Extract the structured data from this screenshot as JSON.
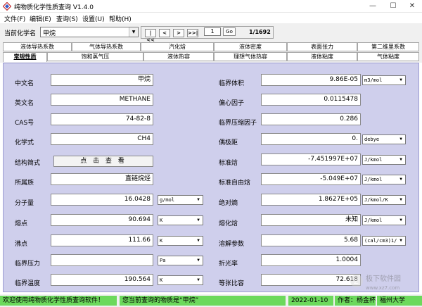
{
  "window": {
    "title": "纯物质化学性质查询 V1.4.0",
    "minimize": "—",
    "maximize": "☐",
    "close": "✕"
  },
  "menu": [
    "文件(F)",
    "编辑(E)",
    "查询(S)",
    "设置(U)",
    "帮助(H)"
  ],
  "toolbar": {
    "label": "当前化学名",
    "compound": "甲烷",
    "nav_first": "|<<",
    "nav_prev": "<",
    "nav_next": ">",
    "nav_last": ">>|",
    "page": "1",
    "go": "Go",
    "page_count": "1/1692"
  },
  "tabs_row1": [
    "液体导热系数",
    "气体导热系数",
    "汽化焓",
    "液体密度",
    "表面张力",
    "第二维里系数"
  ],
  "tabs_row2": [
    "常规性质",
    "饱和蒸气压",
    "液体热容",
    "理想气体热容",
    "液体粘度",
    "气体粘度"
  ],
  "left": [
    {
      "label": "中文名",
      "value": "甲烷"
    },
    {
      "label": "英文名",
      "value": "METHANE"
    },
    {
      "label": "CAS号",
      "value": "74-82-8"
    },
    {
      "label": "化学式",
      "value": "CH4"
    },
    {
      "label": "结构简式",
      "value": "点 击 查 看"
    },
    {
      "label": "所属族",
      "value": "直链烷烃"
    },
    {
      "label": "分子量",
      "value": "16.0428",
      "unit": "g/mol"
    },
    {
      "label": "熔点",
      "value": "90.694",
      "unit": "K"
    },
    {
      "label": "沸点",
      "value": "111.66",
      "unit": "K"
    },
    {
      "label": "临界压力",
      "value": "",
      "unit": "Pa"
    },
    {
      "label": "临界温度",
      "value": "190.564",
      "unit": "K"
    }
  ],
  "right": [
    {
      "label": "临界体积",
      "value": "9.86E-05",
      "unit": "m3/mol"
    },
    {
      "label": "偏心因子",
      "value": "0.0115478"
    },
    {
      "label": "临界压缩因子",
      "value": "0.286"
    },
    {
      "label": "偶极距",
      "value": "0.",
      "unit": "debye"
    },
    {
      "label": "标准焓",
      "value": "-7.451997E+07",
      "unit": "J/kmol"
    },
    {
      "label": "标准自由焓",
      "value": "-5.049E+07",
      "unit": "J/kmol"
    },
    {
      "label": "绝对熵",
      "value": "1.8627E+05",
      "unit": "J/kmol/K"
    },
    {
      "label": "熔化焓",
      "value": "未知",
      "unit": "J/kmol"
    },
    {
      "label": "溶解参数",
      "value": "5.68",
      "unit": "(cal/cm3)1/"
    },
    {
      "label": "折光率",
      "value": "1.0004"
    },
    {
      "label": "等张比容",
      "value": "72.618"
    }
  ],
  "status": {
    "welcome": "欢迎使用纯物质化学性质查询软件！",
    "current": "您当前查询的物质是“甲烷”",
    "date": "2022-01-10",
    "author": "作者：杨金杯",
    "org": "福州大学"
  },
  "watermark": {
    "text1": "极下软件园",
    "text2": "www.xz7.com"
  }
}
